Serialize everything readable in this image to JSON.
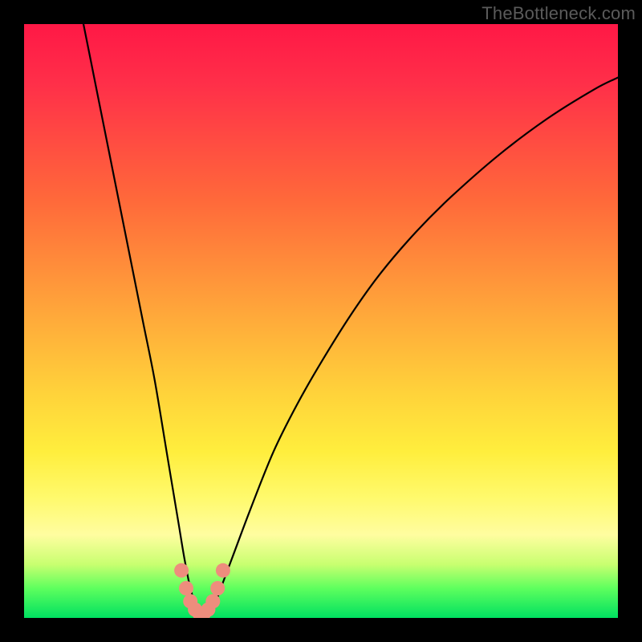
{
  "watermark": "TheBottleneck.com",
  "chart_data": {
    "type": "line",
    "title": "",
    "xlabel": "",
    "ylabel": "",
    "xlim": [
      0,
      100
    ],
    "ylim": [
      0,
      100
    ],
    "grid": false,
    "legend": false,
    "annotations": [],
    "series": [
      {
        "name": "bottleneck-curve",
        "color": "#000000",
        "x": [
          10,
          12,
          14,
          16,
          18,
          20,
          22,
          24,
          25,
          26,
          27,
          28,
          29,
          30,
          31,
          32,
          33.5,
          35,
          38,
          42,
          46,
          50,
          55,
          60,
          66,
          72,
          80,
          88,
          96,
          100
        ],
        "values": [
          100,
          90,
          80,
          70,
          60,
          50,
          40,
          28,
          22,
          16,
          10,
          5,
          2,
          0.5,
          0.5,
          2,
          6,
          10,
          18,
          28,
          36,
          43,
          51,
          58,
          65,
          71,
          78,
          84,
          89,
          91
        ]
      },
      {
        "name": "highlight-points",
        "color": "#ee8d7d",
        "type": "scatter",
        "x": [
          26.5,
          27.3,
          28.0,
          28.8,
          29.5,
          30.3,
          31.0,
          31.8,
          32.6,
          33.5
        ],
        "values": [
          8.0,
          5.0,
          2.8,
          1.4,
          0.8,
          0.8,
          1.4,
          2.8,
          5.0,
          8.0
        ]
      }
    ]
  }
}
